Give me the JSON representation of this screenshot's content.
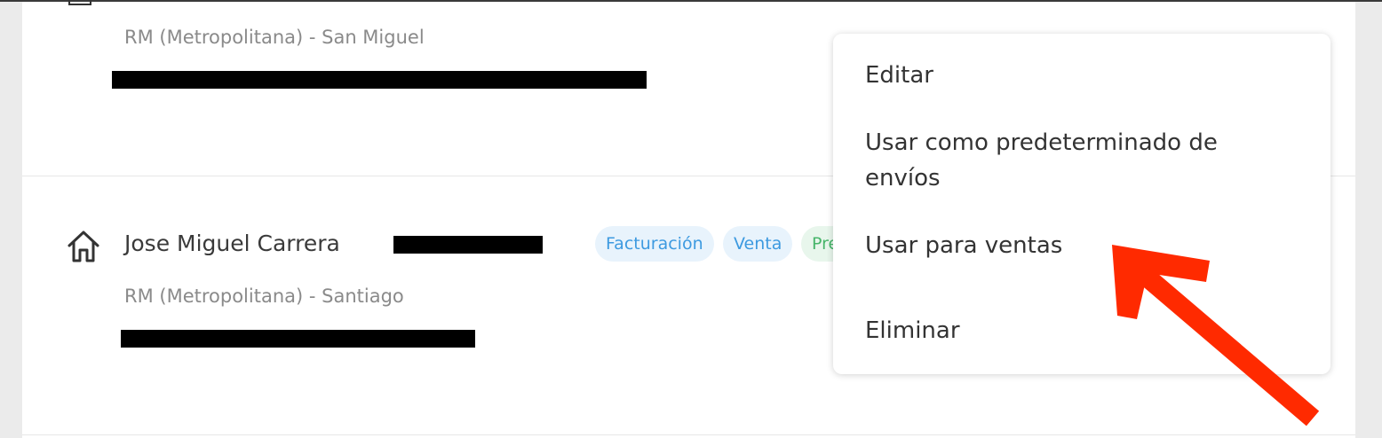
{
  "address_1": {
    "region": "RM (Metropolitana) - San Miguel"
  },
  "address_2": {
    "title": "Jose Miguel Carrera",
    "region": "RM (Metropolitana) - Santiago",
    "icon": "home-icon",
    "tags": [
      {
        "label": "Facturación",
        "color": "#3d9ae0"
      },
      {
        "label": "Venta",
        "color": "#3d9ae0"
      },
      {
        "label": "Pre",
        "color": "#47b56a"
      }
    ]
  },
  "context_menu": {
    "items": [
      {
        "label": "Editar"
      },
      {
        "label": "Usar como predeterminado de envíos"
      },
      {
        "label": "Usar para ventas"
      },
      {
        "label": "Eliminar"
      }
    ]
  },
  "annotation": {
    "type": "red arrow",
    "color": "#ff2a00",
    "points_to": "Usar para ventas"
  }
}
